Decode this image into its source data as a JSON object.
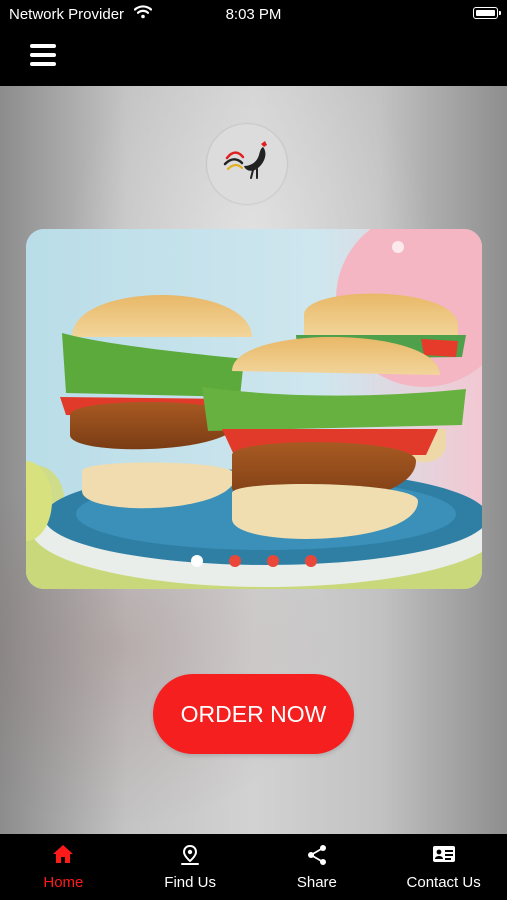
{
  "status_bar": {
    "carrier": "Network Provider",
    "time": "8:03 PM"
  },
  "nav": {
    "menu_icon": "hamburger-menu-icon"
  },
  "logo": {
    "icon": "rooster-logo"
  },
  "banner": {
    "image": "veggie-burgers-photo",
    "slide_count": 4,
    "active_slide": 1,
    "colors": {
      "dot_active": "#ffffff",
      "dot_inactive": "#e8473a"
    }
  },
  "order_button": {
    "label": "ORDER NOW",
    "color": "#f51f1f"
  },
  "tabs": [
    {
      "label": "Home",
      "icon": "home-icon",
      "active": true
    },
    {
      "label": "Find Us",
      "icon": "location-pin-icon",
      "active": false
    },
    {
      "label": "Share",
      "icon": "share-icon",
      "active": false
    },
    {
      "label": "Contact Us",
      "icon": "contact-card-icon",
      "active": false
    }
  ],
  "colors": {
    "accent": "#ff1a1a",
    "bars": "#000000"
  }
}
